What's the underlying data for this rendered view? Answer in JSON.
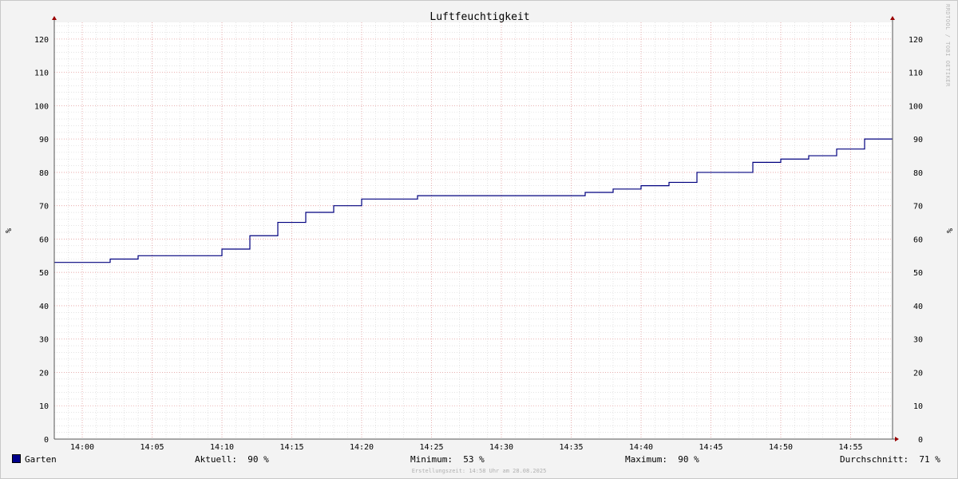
{
  "chart_data": {
    "type": "line",
    "title": "Luftfeuchtigkeit",
    "ylabel": "%",
    "ylabel_right": "%",
    "ylim": [
      0,
      125
    ],
    "yticks": [
      0,
      10,
      20,
      30,
      40,
      50,
      60,
      70,
      80,
      90,
      100,
      110,
      120
    ],
    "xlim": [
      "13:58",
      "14:58"
    ],
    "xticks": [
      "14:00",
      "14:05",
      "14:10",
      "14:15",
      "14:20",
      "14:25",
      "14:30",
      "14:35",
      "14:40",
      "14:45",
      "14:50",
      "14:55"
    ],
    "grid": true,
    "step": true,
    "series": [
      {
        "name": "Garten",
        "color": "#00007f",
        "x": [
          "13:58",
          "14:02",
          "14:04",
          "14:10",
          "14:12",
          "14:14",
          "14:16",
          "14:18",
          "14:20",
          "14:24",
          "14:36",
          "14:38",
          "14:40",
          "14:42",
          "14:44",
          "14:48",
          "14:50",
          "14:52",
          "14:54",
          "14:56",
          "14:58"
        ],
        "values": [
          53,
          54,
          55,
          57,
          61,
          65,
          68,
          70,
          72,
          73,
          74,
          75,
          76,
          77,
          80,
          83,
          84,
          85,
          87,
          90,
          90
        ]
      }
    ]
  },
  "legend": {
    "series_name": "Garten",
    "series_color": "#00008b",
    "current_label": "Aktuell:",
    "current_value": "90 %",
    "min_label": "Minimum:",
    "min_value": "53 %",
    "max_label": "Maximum:",
    "max_value": "90 %",
    "avg_label": "Durchschnitt:",
    "avg_value": "71 %"
  },
  "footer": "Erstellungszeit: 14:58 Uhr am 28.08.2025",
  "watermark": "RRDTOOL / TOBI OETIKER"
}
